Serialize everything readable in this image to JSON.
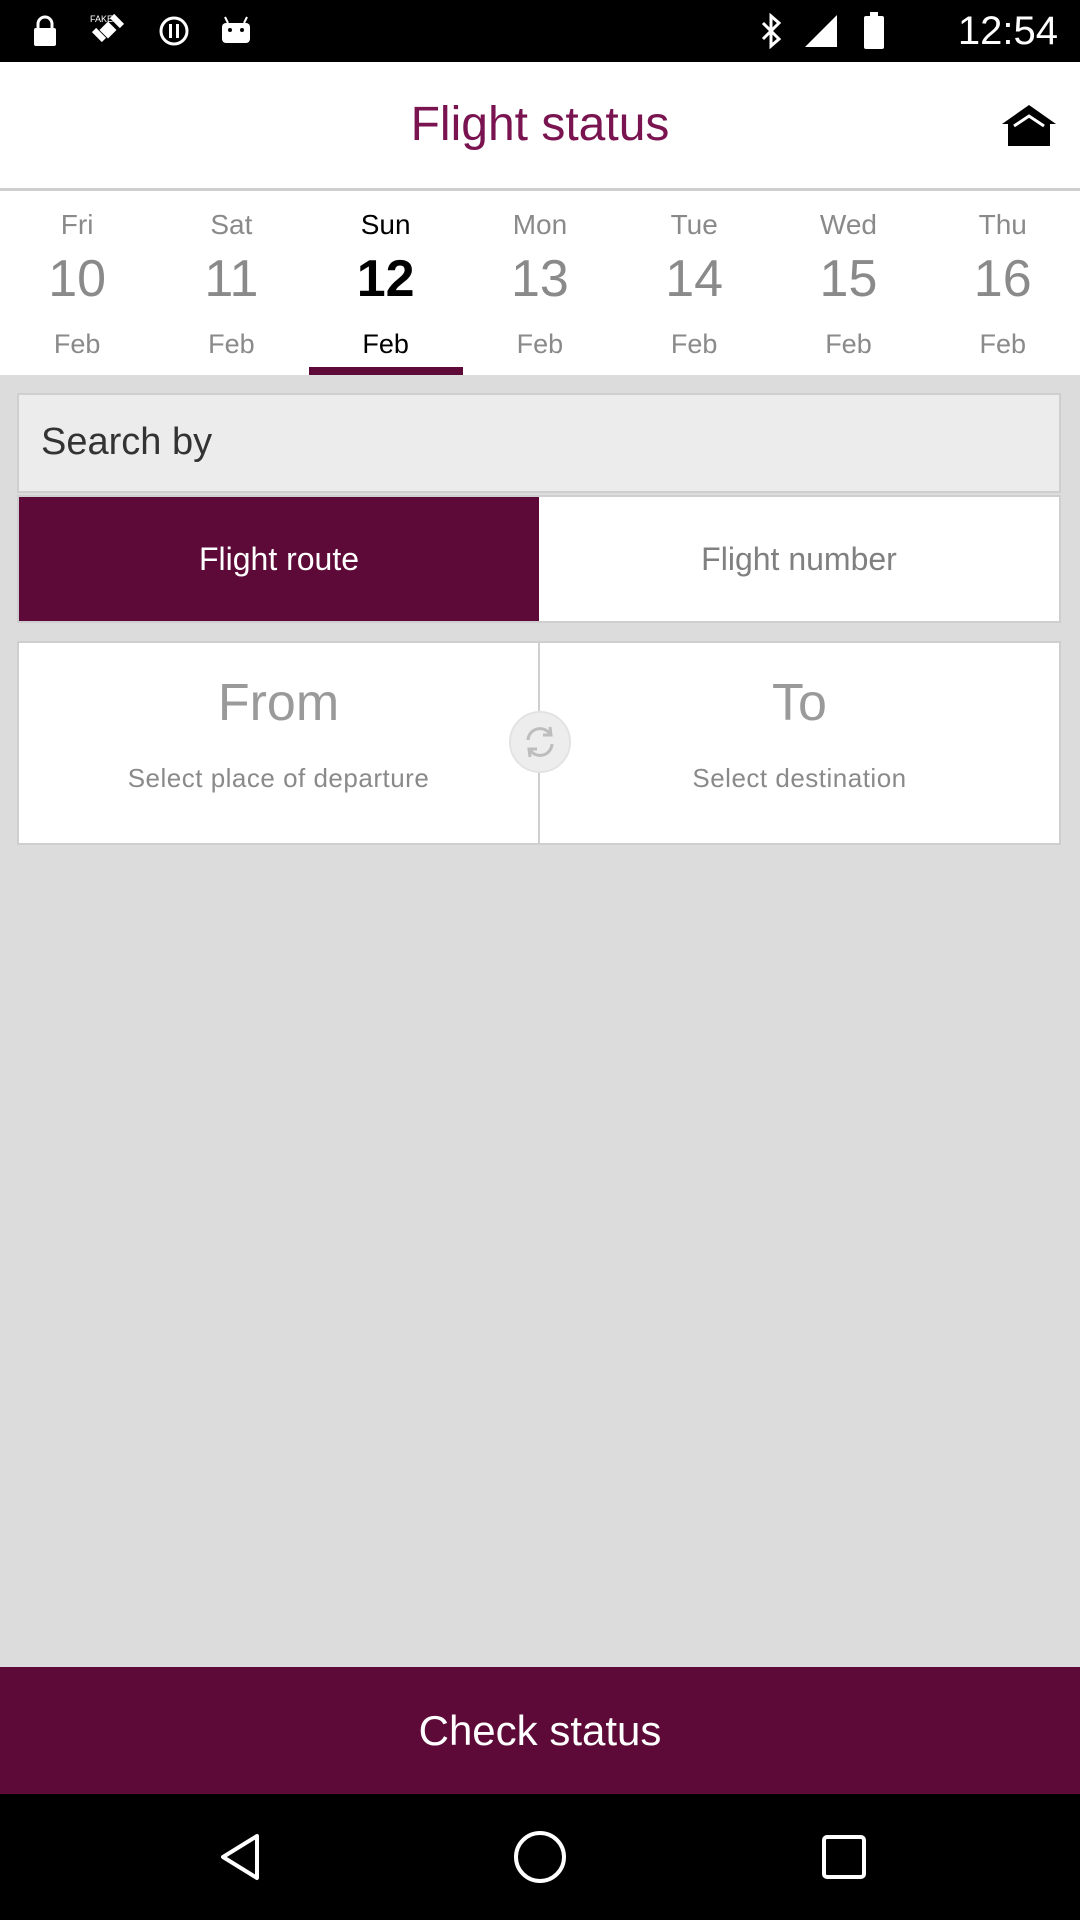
{
  "status_bar": {
    "time": "12:54",
    "icons": [
      "lock-icon",
      "satellite-icon",
      "info-icon",
      "android-icon",
      "bluetooth-icon",
      "signal-icon",
      "battery-icon"
    ]
  },
  "header": {
    "title": "Flight status",
    "home_icon": "home-icon"
  },
  "dates": [
    {
      "dow": "Fri",
      "day": "10",
      "month": "Feb",
      "selected": false
    },
    {
      "dow": "Sat",
      "day": "11",
      "month": "Feb",
      "selected": false
    },
    {
      "dow": "Sun",
      "day": "12",
      "month": "Feb",
      "selected": true
    },
    {
      "dow": "Mon",
      "day": "13",
      "month": "Feb",
      "selected": false
    },
    {
      "dow": "Tue",
      "day": "14",
      "month": "Feb",
      "selected": false
    },
    {
      "dow": "Wed",
      "day": "15",
      "month": "Feb",
      "selected": false
    },
    {
      "dow": "Thu",
      "day": "16",
      "month": "Feb",
      "selected": false
    }
  ],
  "search": {
    "label": "Search by",
    "options": [
      {
        "label": "Flight route",
        "selected": true
      },
      {
        "label": "Flight number",
        "selected": false
      }
    ]
  },
  "route": {
    "from_label": "From",
    "from_placeholder": "Select place of departure",
    "to_label": "To",
    "to_placeholder": "Select destination",
    "swap_icon": "swap-icon"
  },
  "action": {
    "check_label": "Check status"
  },
  "colors": {
    "accent": "#5e0a38",
    "title": "#7a1450"
  },
  "nav": {
    "icons": [
      "back-icon",
      "home-circle-icon",
      "recents-icon"
    ]
  }
}
